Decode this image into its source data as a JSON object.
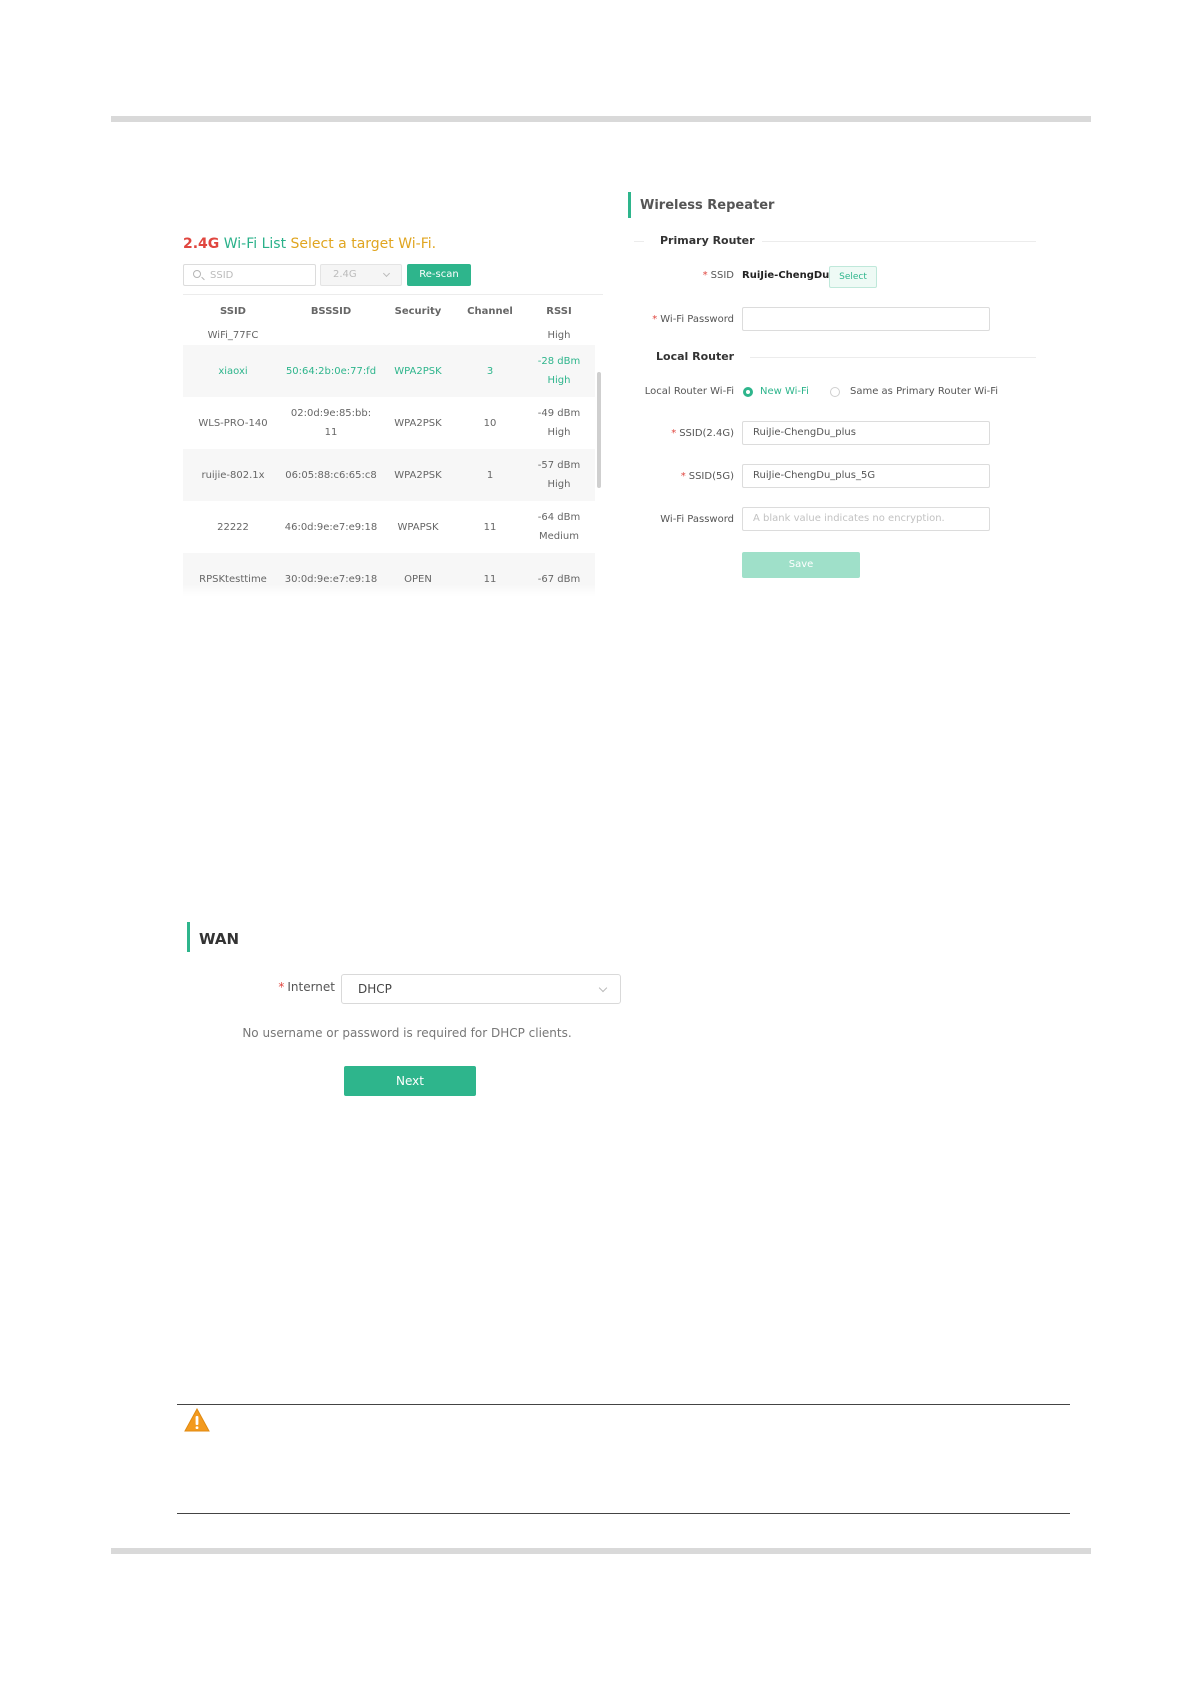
{
  "wifi_list": {
    "title_band": "2.4G",
    "title_list": "Wi-Fi List",
    "title_select": "Select a target Wi-Fi.",
    "search_placeholder": "SSID",
    "band_value": "2.4G",
    "rescan_label": "Re-scan",
    "columns": [
      "SSID",
      "BSSSID",
      "Security",
      "Channel",
      "RSSI"
    ],
    "partial_top": {
      "ssid": "WiFi_77FC",
      "rssi": "High"
    },
    "rows": [
      {
        "ssid": "xiaoxi",
        "bssid": "50:64:2b:0e:77:fd",
        "security": "WPA2PSK",
        "channel": "3",
        "rssi_dbm": "-28 dBm",
        "rssi_level": "High"
      },
      {
        "ssid": "WLS-PRO-140",
        "bssid": "02:0d:9e:85:bb:11",
        "security": "WPA2PSK",
        "channel": "10",
        "rssi_dbm": "-49 dBm",
        "rssi_level": "High"
      },
      {
        "ssid": "ruijie-802.1x",
        "bssid": "06:05:88:c6:65:c8",
        "security": "WPA2PSK",
        "channel": "1",
        "rssi_dbm": "-57 dBm",
        "rssi_level": "High"
      },
      {
        "ssid": "22222",
        "bssid": "46:0d:9e:e7:e9:18",
        "security": "WPAPSK",
        "channel": "11",
        "rssi_dbm": "-64 dBm",
        "rssi_level": "Medium"
      }
    ],
    "partial_bottom": {
      "ssid": "RPSKtesttime",
      "bssid": "30:0d:9e:e7:e9:18",
      "security": "OPEN",
      "channel": "11",
      "rssi": "-67 dBm"
    }
  },
  "repeater": {
    "title": "Wireless Repeater",
    "primary_heading": "Primary Router",
    "ssid_label": "SSID",
    "ssid_value": "RuiJie-ChengDu",
    "select_label": "Select",
    "password_label": "Wi-Fi Password",
    "password_value": "",
    "local_heading": "Local Router",
    "local_wifi_label": "Local Router Wi-Fi",
    "option_new": "New Wi-Fi",
    "option_same": "Same as Primary Router Wi-Fi",
    "ssid24_label": "SSID(2.4G)",
    "ssid24_value": "RuiJie-ChengDu_plus",
    "ssid5_label": "SSID(5G)",
    "ssid5_value": "RuiJie-ChengDu_plus_5G",
    "local_password_label": "Wi-Fi Password",
    "local_password_placeholder": "A blank value indicates no encryption.",
    "save_label": "Save"
  },
  "wan": {
    "title": "WAN",
    "internet_label": "Internet",
    "internet_value": "DHCP",
    "note": "No username or password is required for DHCP clients.",
    "next_label": "Next"
  },
  "colors": {
    "accent": "#2eb58c",
    "required": "#e0463f",
    "highlight": "#e0a520",
    "save_disabled": "#9fe0c9"
  }
}
